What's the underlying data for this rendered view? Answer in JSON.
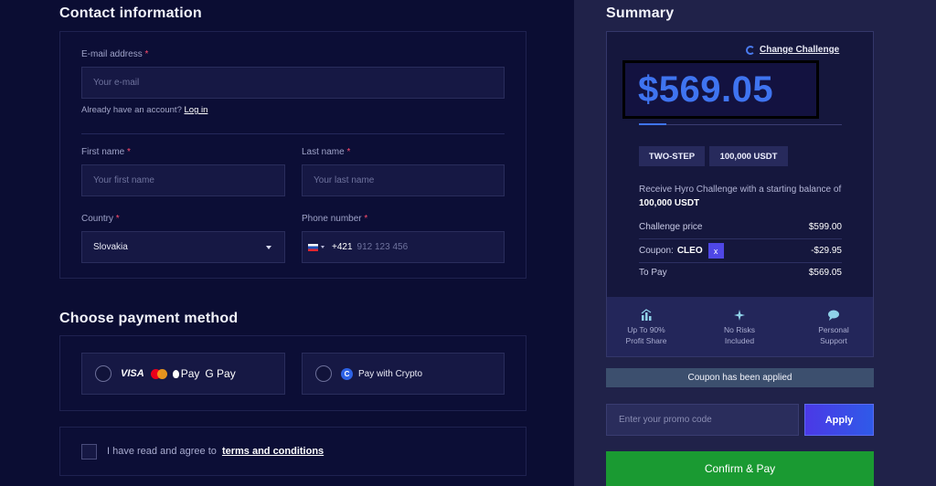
{
  "contact": {
    "title": "Contact information",
    "email_label": "E-mail address",
    "required_mark": "*",
    "email_placeholder": "Your e-mail",
    "already_text": "Already have an account?",
    "login_link": "Log in",
    "first_name_label": "First name",
    "first_name_placeholder": "Your first name",
    "last_name_label": "Last name",
    "last_name_placeholder": "Your last name",
    "country_label": "Country",
    "country_value": "Slovakia",
    "phone_label": "Phone number",
    "phone_code": "+421",
    "phone_placeholder": "912 123 456"
  },
  "payment": {
    "title": "Choose payment method",
    "card_brands": [
      "VISA",
      "Pay",
      "G Pay"
    ],
    "crypto_label": "Pay with Crypto"
  },
  "terms": {
    "text": "I have read and agree to",
    "link": "terms and conditions"
  },
  "summary": {
    "title": "Summary",
    "change_challenge": "Change Challenge",
    "total": "$569.05",
    "chips": [
      "TWO-STEP",
      "100,000 USDT"
    ],
    "description_prefix": "Receive Hyro Challenge with a starting balance of",
    "description_amount": "100,000 USDT",
    "rows": [
      {
        "label": "Challenge price",
        "value": "$599.00"
      },
      {
        "label": "Coupon:",
        "code": "CLEO",
        "remove": "x",
        "value": "-$29.95"
      },
      {
        "label": "To Pay",
        "value": "$569.05"
      }
    ],
    "features": [
      {
        "icon": "profit-share-icon",
        "line1": "Up To 90%",
        "line2": "Profit Share"
      },
      {
        "icon": "sparkle-icon",
        "line1": "No Risks",
        "line2": "Included"
      },
      {
        "icon": "support-chat-icon",
        "line1": "Personal",
        "line2": "Support"
      }
    ],
    "coupon_applied": "Coupon has been applied",
    "promo_placeholder": "Enter your promo code",
    "apply_label": "Apply",
    "confirm_label": "Confirm & Pay"
  },
  "colors": {
    "accent_blue": "#3b6cf0",
    "confirm_green": "#1a9a32",
    "apply_gradient_start": "#4b39e6",
    "apply_gradient_end": "#2f5ae8"
  }
}
